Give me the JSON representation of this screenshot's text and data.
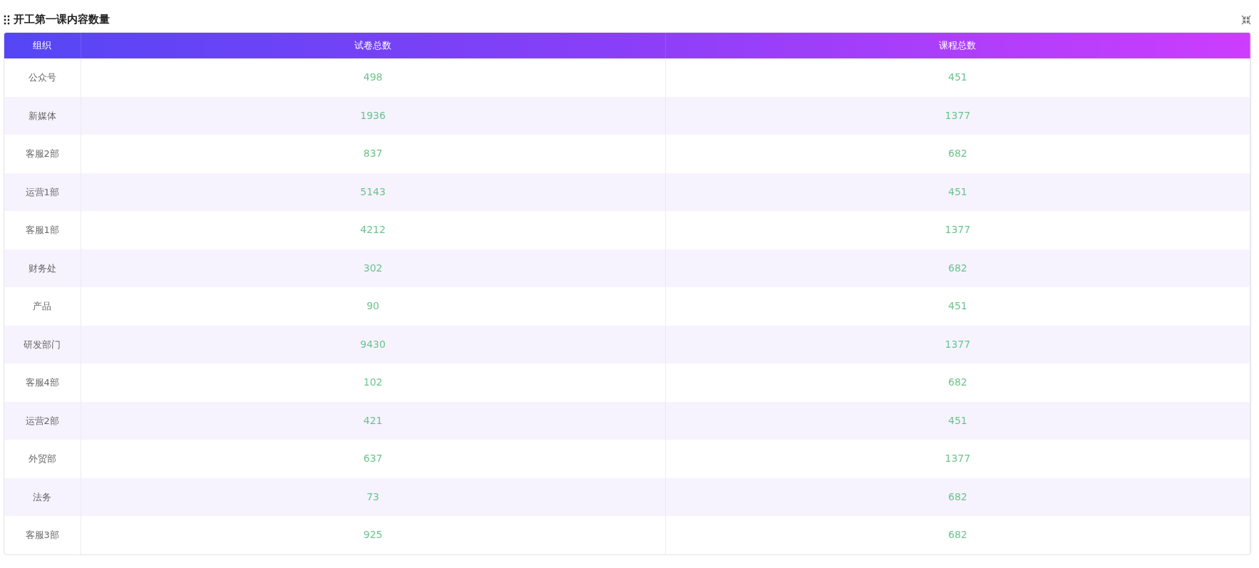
{
  "panel": {
    "title": "开工第一课内容数量"
  },
  "table": {
    "columns": [
      "组织",
      "试卷总数",
      "课程总数"
    ],
    "rows": [
      [
        "公众号",
        "498",
        "451"
      ],
      [
        "新媒体",
        "1936",
        "1377"
      ],
      [
        "客服2部",
        "837",
        "682"
      ],
      [
        "运营1部",
        "5143",
        "451"
      ],
      [
        "客服1部",
        "4212",
        "1377"
      ],
      [
        "财务处",
        "302",
        "682"
      ],
      [
        "产品",
        "90",
        "451"
      ],
      [
        "研发部门",
        "9430",
        "1377"
      ],
      [
        "客服4部",
        "102",
        "682"
      ],
      [
        "运营2部",
        "421",
        "451"
      ],
      [
        "外贸部",
        "637",
        "1377"
      ],
      [
        "法务",
        "73",
        "682"
      ],
      [
        "客服3部",
        "925",
        "682"
      ]
    ]
  }
}
